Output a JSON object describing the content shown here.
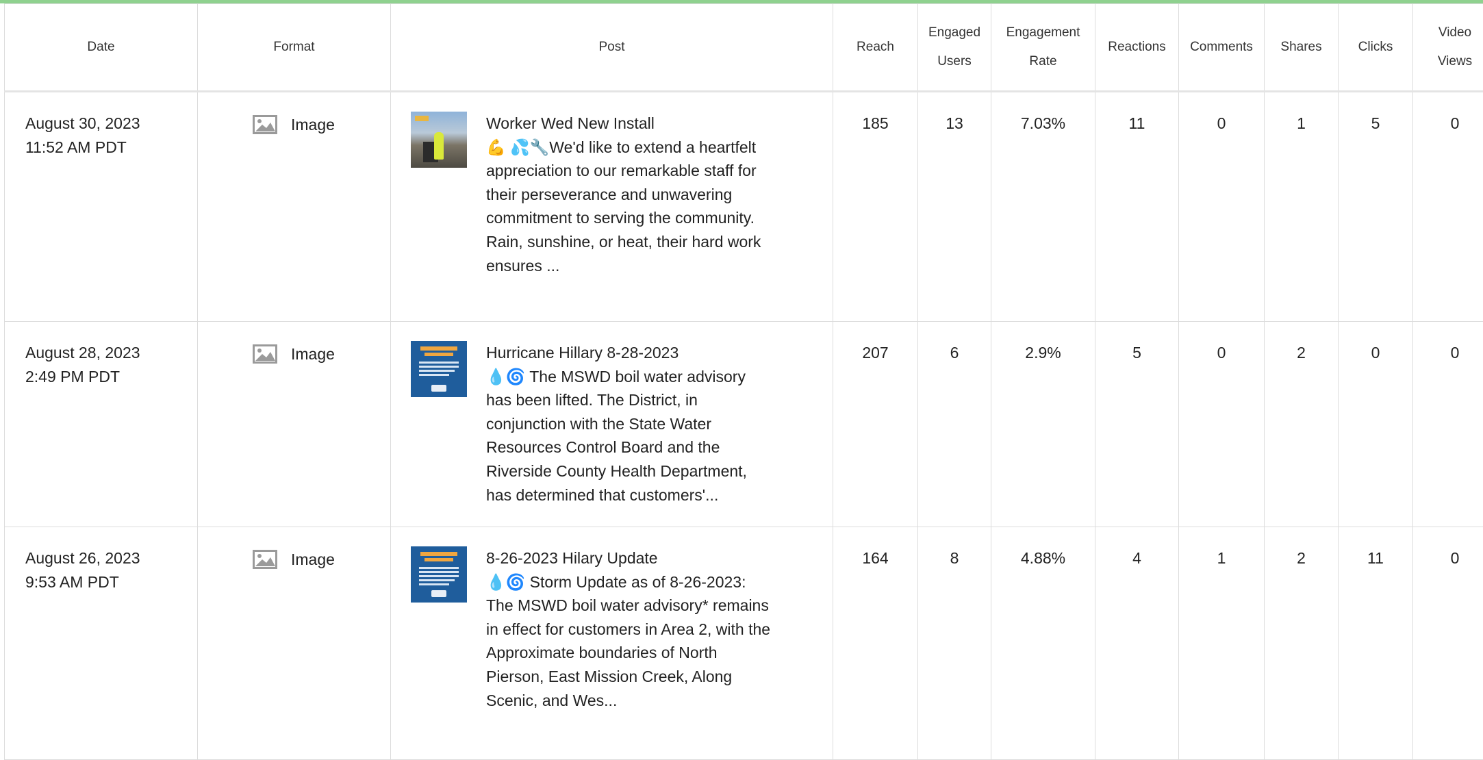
{
  "colors": {
    "accent_bar": "#8fd18f",
    "border": "#dcdcdc"
  },
  "columns": {
    "date": "Date",
    "format": "Format",
    "post": "Post",
    "reach": "Reach",
    "engaged_users_line1": "Engaged",
    "engaged_users_line2": "Users",
    "engagement_rate_line1": "Engagement",
    "engagement_rate_line2": "Rate",
    "reactions": "Reactions",
    "comments": "Comments",
    "shares": "Shares",
    "clicks": "Clicks",
    "video_views_line1": "Video",
    "video_views_line2": "Views"
  },
  "rows": [
    {
      "date": "August 30, 2023",
      "time": "11:52 AM PDT",
      "format_icon": "image-icon",
      "format": "Image",
      "thumbnail": "worker-photo",
      "post_title": "Worker Wed New Install",
      "post_body": "💪 💦🔧We'd like to extend a heartfelt appreciation to our remarkable staff for their perseverance and unwavering commitment to serving the community. Rain, sunshine, or heat, their hard work ensures ...",
      "reach": "185",
      "engaged_users": "13",
      "engagement_rate": "7.03%",
      "reactions": "11",
      "comments": "0",
      "shares": "1",
      "clicks": "5",
      "video_views": "0"
    },
    {
      "date": "August 28, 2023",
      "time": "2:49 PM PDT",
      "format_icon": "image-icon",
      "format": "Image",
      "thumbnail": "advisory-graphic",
      "post_title": "Hurricane Hillary 8-28-2023",
      "post_body": "💧🌀 The MSWD boil water advisory has been lifted. The District, in conjunction with the State Water Resources Control Board and the Riverside County Health Department, has determined that customers'...",
      "reach": "207",
      "engaged_users": "6",
      "engagement_rate": "2.9%",
      "reactions": "5",
      "comments": "0",
      "shares": "2",
      "clicks": "0",
      "video_views": "0"
    },
    {
      "date": "August 26, 2023",
      "time": "9:53 AM PDT",
      "format_icon": "image-icon",
      "format": "Image",
      "thumbnail": "update-graphic",
      "post_title": "8-26-2023 Hilary Update",
      "post_body": "💧🌀 Storm Update as of 8-26-2023: The MSWD boil water advisory* remains in effect for customers in Area 2, with the Approximate boundaries of North Pierson, East Mission Creek, Along Scenic, and Wes...",
      "reach": "164",
      "engaged_users": "8",
      "engagement_rate": "4.88%",
      "reactions": "4",
      "comments": "1",
      "shares": "2",
      "clicks": "11",
      "video_views": "0"
    }
  ]
}
